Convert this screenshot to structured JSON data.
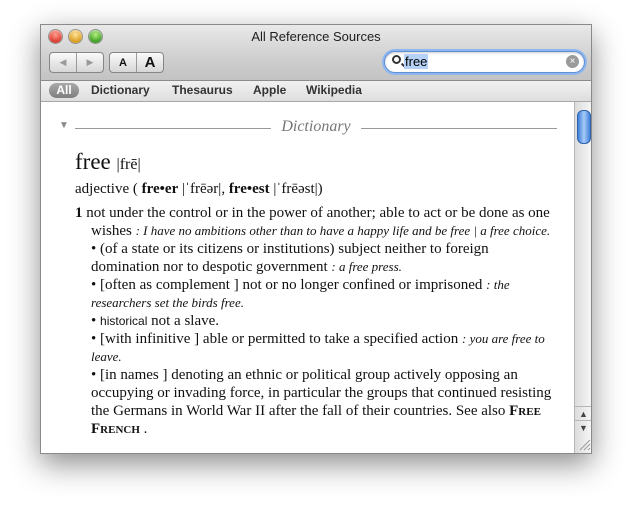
{
  "window": {
    "title": "All Reference Sources"
  },
  "toolbar": {
    "back_icon": "◀",
    "forward_icon": "▶",
    "font_smaller": "A",
    "font_larger": "A"
  },
  "search": {
    "value": "free"
  },
  "scopes": [
    "All",
    "Dictionary",
    "Thesaurus",
    "Apple",
    "Wikipedia"
  ],
  "section": {
    "title": "Dictionary"
  },
  "entry": {
    "headword": "free",
    "pron": "|frē|",
    "pos": "adjective",
    "comparative": "fre•er",
    "comparative_pron": "|ˈfrēər|",
    "superlative": "fre•est",
    "superlative_pron": "|ˈfrēəst|",
    "senses": [
      {
        "num": "1",
        "text": "not under the control or in the power of another; able to act or be done as one wishes",
        "example": ": I have no ambitions other than to have a happy life and be free | a free choice."
      },
      {
        "text": "(of a state or its citizens or institutions) subject neither to foreign domination nor to despotic government",
        "example": ": a free press."
      },
      {
        "label": "[often as complement ]",
        "text": "not or no longer confined or imprisoned",
        "example": ": the researchers set the birds free."
      },
      {
        "register": "historical",
        "text": "not a slave."
      },
      {
        "label": "[with infinitive ]",
        "text": "able or permitted to take a specified action",
        "example": ": you are free to leave."
      },
      {
        "label": "[in names ]",
        "text": "denoting an ethnic or political group actively opposing an occupying or invading force, in particular the groups that continued resisting the Germans in World War II after the fall of their countries. See also",
        "xref": "Free French",
        "tail": "."
      }
    ]
  }
}
